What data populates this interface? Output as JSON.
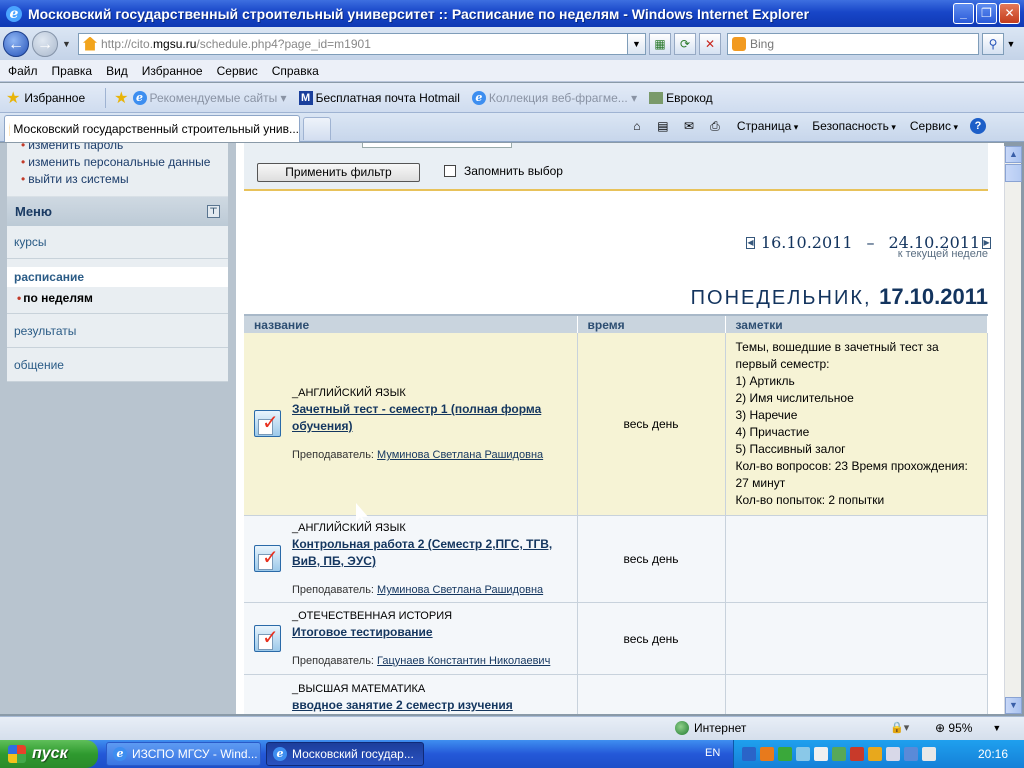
{
  "window": {
    "title": "Московский государственный строительный университет :: Расписание по неделям - Windows Internet Explorer"
  },
  "address": {
    "url_prefix": "http://cito.",
    "url_domain": "mgsu.ru",
    "url_suffix": "/schedule.php4?page_id=m1901",
    "search_placeholder": "Bing"
  },
  "menu": [
    "Файл",
    "Правка",
    "Вид",
    "Избранное",
    "Сервис",
    "Справка"
  ],
  "favorites": {
    "label": "Избранное",
    "items": [
      "Рекомендуемые сайты ▾",
      "Бесплатная почта Hotmail",
      "Коллекция веб-фрагме... ▾",
      "Еврокод"
    ]
  },
  "tabs": {
    "active": "Московский государственный строительный унив..."
  },
  "commandbar": {
    "page": "Страница",
    "safety": "Безопасность",
    "service": "Сервис"
  },
  "sidebar": {
    "top_links": [
      "изменить пароль",
      "изменить персональные данные",
      "выйти из системы"
    ],
    "menu_title": "Меню",
    "items": {
      "courses": "курсы",
      "schedule": "расписание",
      "schedule_sub": "по неделям",
      "results": "результаты",
      "communication": "общение"
    }
  },
  "filter": {
    "apply_label": "Применить фильтр",
    "remember_label": "Запомнить выбор"
  },
  "week": {
    "start": "16.10.2011",
    "end": "24.10.2011",
    "to_current": "к текущей неделе"
  },
  "day": {
    "name": "ПОНЕДЕЛЬНИК,",
    "date": "17.10.2011"
  },
  "table": {
    "headers": [
      "название",
      "время",
      "заметки"
    ],
    "rows": [
      {
        "subject": "_АНГЛИЙСКИЙ ЯЗЫК",
        "title": "Зачетный тест - семестр 1 (полная форма обучения)",
        "teacher_label": "Преподаватель:",
        "teacher": "Муминова Светлана Рашидовна",
        "time": "весь день",
        "notes": [
          "Темы, вошедшие в зачетный тест за первый семестр:",
          "1) Артикль",
          "2) Имя числительное",
          "3) Наречие",
          "4) Причастие",
          "5) Пассивный залог",
          "Кол-во вопросов: 23 Время прохождения: 27 минут",
          "Кол-во попыток: 2 попытки"
        ]
      },
      {
        "subject": "_АНГЛИЙСКИЙ ЯЗЫК",
        "title": "Контрольная работа 2 (Семестр 2,ПГС, ТГВ, ВиВ, ПБ, ЭУС)",
        "teacher_label": "Преподаватель:",
        "teacher": "Муминова Светлана Рашидовна",
        "time": "весь день",
        "notes": []
      },
      {
        "subject": "_ОТЕЧЕСТВЕННАЯ ИСТОРИЯ",
        "title": "Итоговое тестирование",
        "teacher_label": "Преподаватель:",
        "teacher": "Гацунаев Константин Николаевич",
        "time": "весь день",
        "notes": []
      },
      {
        "subject": "_ВЫСШАЯ МАТЕМАТИКА",
        "title": "вводное занятие 2 семестр изучения",
        "teacher_label": "",
        "teacher": "",
        "time": "",
        "notes": []
      }
    ]
  },
  "status": {
    "zone": "Интернет",
    "zoom": "95%"
  },
  "taskbar": {
    "start": "пуск",
    "task1": "ИЗСПО МГСУ - Wind...",
    "task2": "Московский государ...",
    "lang": "EN",
    "clock": "20:16"
  }
}
